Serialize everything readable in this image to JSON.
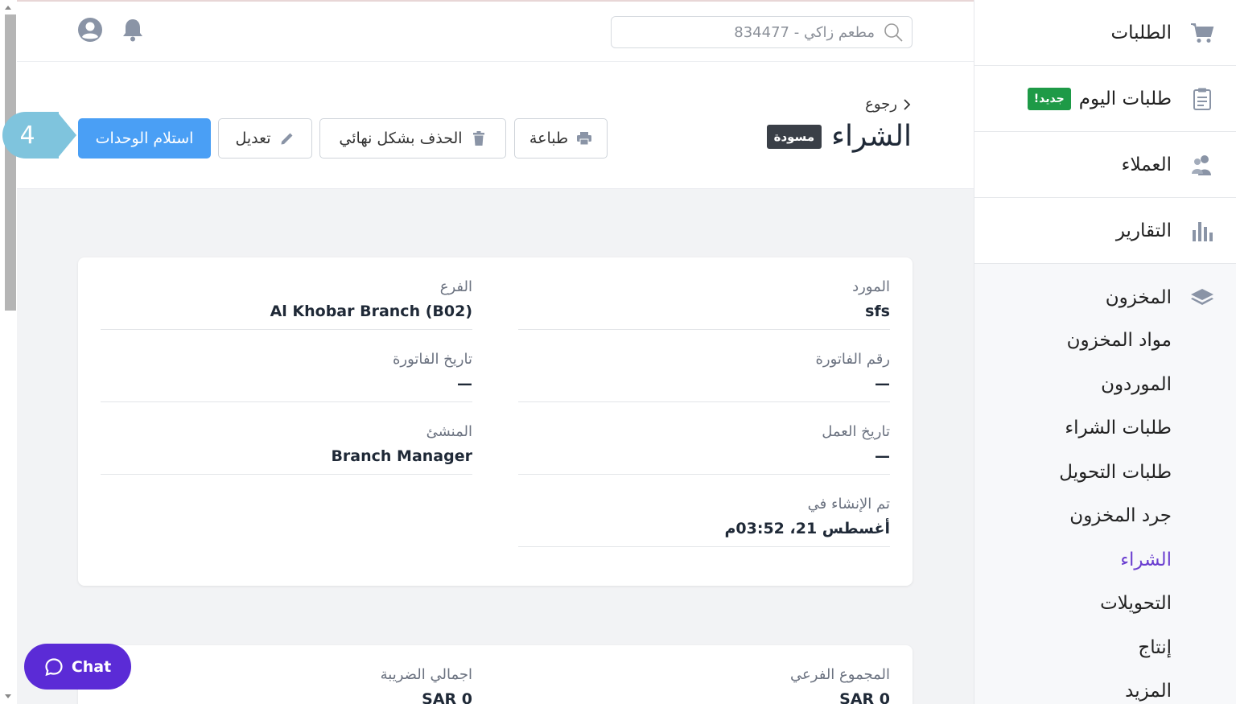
{
  "sidebar": {
    "top_items": [
      {
        "label": "الطلبات",
        "icon": "cart-icon"
      },
      {
        "label": "طلبات اليوم",
        "icon": "clipboard-icon",
        "badge": "جديد!"
      },
      {
        "label": "العملاء",
        "icon": "users-icon"
      },
      {
        "label": "التقارير",
        "icon": "bar-chart-icon"
      }
    ],
    "section": {
      "label": "المخزون",
      "icon": "layers-icon",
      "items": [
        "مواد المخزون",
        "الموردون",
        "طلبات الشراء",
        "طلبات التحويل",
        "جرد المخزون",
        "الشراء",
        "التحويلات",
        "إنتاج",
        "المزيد"
      ],
      "active_index": 5
    }
  },
  "header": {
    "search_placeholder": "مطعم زاكي - 834477",
    "icons": [
      "bell-icon",
      "user-circle-icon"
    ]
  },
  "page": {
    "back_label": "رجوع",
    "title": "الشراء",
    "status": "مسودة",
    "buttons": {
      "print": "طباعة",
      "delete": "الحذف بشكل نهائي",
      "edit": "تعديل",
      "receive": "استلام الوحدات"
    }
  },
  "step_marker": "4",
  "details": {
    "supplier_label": "المورد",
    "supplier": "sfs",
    "branch_label": "الفرع",
    "branch": "Al Khobar Branch (B02)",
    "invoice_number_label": "رقم الفاتورة",
    "invoice_number": "—",
    "invoice_date_label": "تاريخ الفاتورة",
    "invoice_date": "—",
    "business_date_label": "تاريخ العمل",
    "business_date": "—",
    "creator_label": "المنشئ",
    "creator": "Branch Manager",
    "created_at_label": "تم الإنشاء في",
    "created_at": "أغسطس 21، 03:52م"
  },
  "totals": {
    "subtotal_label": "المجموع الفرعي",
    "subtotal": "SAR 0",
    "tax_label": "اجمالي الضريبة",
    "tax": "SAR 0"
  },
  "chat_label": "Chat",
  "colors": {
    "primary": "#4a9ff5",
    "active": "#6b3fd0",
    "badge_new": "#1e9a47",
    "chat": "#5b2bd6"
  }
}
